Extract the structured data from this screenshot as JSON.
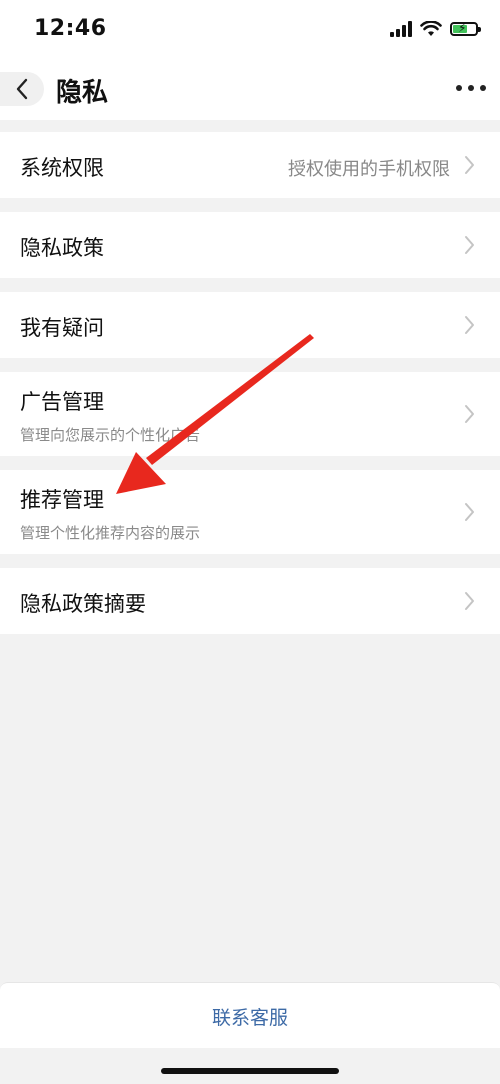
{
  "status_bar": {
    "time": "12:46"
  },
  "nav": {
    "title": "隐私",
    "back_icon": "chevron-left-icon",
    "more_icon": "more-dots-icon"
  },
  "items": [
    {
      "title": "系统权限",
      "value": "授权使用的手机权限",
      "subtitle": ""
    },
    {
      "title": "隐私政策",
      "value": "",
      "subtitle": ""
    },
    {
      "title": "我有疑问",
      "value": "",
      "subtitle": ""
    },
    {
      "title": "广告管理",
      "value": "",
      "subtitle": "管理向您展示的个性化广告"
    },
    {
      "title": "推荐管理",
      "value": "",
      "subtitle": "管理个性化推荐内容的展示"
    },
    {
      "title": "隐私政策摘要",
      "value": "",
      "subtitle": ""
    }
  ],
  "footer": {
    "contact_label": "联系客服"
  },
  "colors": {
    "background": "#f2f2f2",
    "link": "#3d6aa6",
    "annotation_arrow": "#e8281e"
  }
}
